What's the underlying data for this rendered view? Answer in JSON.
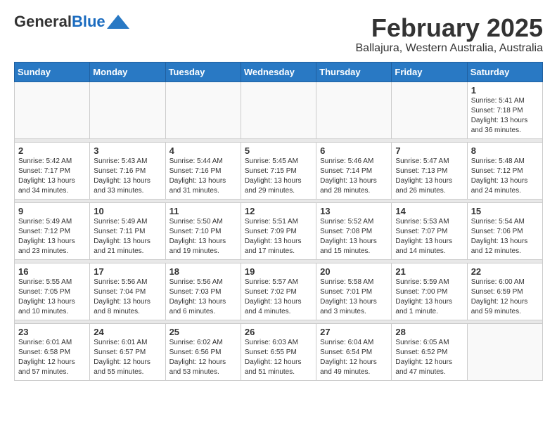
{
  "header": {
    "logo_general": "General",
    "logo_blue": "Blue",
    "title": "February 2025",
    "subtitle": "Ballajura, Western Australia, Australia"
  },
  "days_of_week": [
    "Sunday",
    "Monday",
    "Tuesday",
    "Wednesday",
    "Thursday",
    "Friday",
    "Saturday"
  ],
  "weeks": [
    {
      "days": [
        {
          "number": "",
          "info": ""
        },
        {
          "number": "",
          "info": ""
        },
        {
          "number": "",
          "info": ""
        },
        {
          "number": "",
          "info": ""
        },
        {
          "number": "",
          "info": ""
        },
        {
          "number": "",
          "info": ""
        },
        {
          "number": "1",
          "info": "Sunrise: 5:41 AM\nSunset: 7:18 PM\nDaylight: 13 hours\nand 36 minutes."
        }
      ]
    },
    {
      "days": [
        {
          "number": "2",
          "info": "Sunrise: 5:42 AM\nSunset: 7:17 PM\nDaylight: 13 hours\nand 34 minutes."
        },
        {
          "number": "3",
          "info": "Sunrise: 5:43 AM\nSunset: 7:16 PM\nDaylight: 13 hours\nand 33 minutes."
        },
        {
          "number": "4",
          "info": "Sunrise: 5:44 AM\nSunset: 7:16 PM\nDaylight: 13 hours\nand 31 minutes."
        },
        {
          "number": "5",
          "info": "Sunrise: 5:45 AM\nSunset: 7:15 PM\nDaylight: 13 hours\nand 29 minutes."
        },
        {
          "number": "6",
          "info": "Sunrise: 5:46 AM\nSunset: 7:14 PM\nDaylight: 13 hours\nand 28 minutes."
        },
        {
          "number": "7",
          "info": "Sunrise: 5:47 AM\nSunset: 7:13 PM\nDaylight: 13 hours\nand 26 minutes."
        },
        {
          "number": "8",
          "info": "Sunrise: 5:48 AM\nSunset: 7:12 PM\nDaylight: 13 hours\nand 24 minutes."
        }
      ]
    },
    {
      "days": [
        {
          "number": "9",
          "info": "Sunrise: 5:49 AM\nSunset: 7:12 PM\nDaylight: 13 hours\nand 23 minutes."
        },
        {
          "number": "10",
          "info": "Sunrise: 5:49 AM\nSunset: 7:11 PM\nDaylight: 13 hours\nand 21 minutes."
        },
        {
          "number": "11",
          "info": "Sunrise: 5:50 AM\nSunset: 7:10 PM\nDaylight: 13 hours\nand 19 minutes."
        },
        {
          "number": "12",
          "info": "Sunrise: 5:51 AM\nSunset: 7:09 PM\nDaylight: 13 hours\nand 17 minutes."
        },
        {
          "number": "13",
          "info": "Sunrise: 5:52 AM\nSunset: 7:08 PM\nDaylight: 13 hours\nand 15 minutes."
        },
        {
          "number": "14",
          "info": "Sunrise: 5:53 AM\nSunset: 7:07 PM\nDaylight: 13 hours\nand 14 minutes."
        },
        {
          "number": "15",
          "info": "Sunrise: 5:54 AM\nSunset: 7:06 PM\nDaylight: 13 hours\nand 12 minutes."
        }
      ]
    },
    {
      "days": [
        {
          "number": "16",
          "info": "Sunrise: 5:55 AM\nSunset: 7:05 PM\nDaylight: 13 hours\nand 10 minutes."
        },
        {
          "number": "17",
          "info": "Sunrise: 5:56 AM\nSunset: 7:04 PM\nDaylight: 13 hours\nand 8 minutes."
        },
        {
          "number": "18",
          "info": "Sunrise: 5:56 AM\nSunset: 7:03 PM\nDaylight: 13 hours\nand 6 minutes."
        },
        {
          "number": "19",
          "info": "Sunrise: 5:57 AM\nSunset: 7:02 PM\nDaylight: 13 hours\nand 4 minutes."
        },
        {
          "number": "20",
          "info": "Sunrise: 5:58 AM\nSunset: 7:01 PM\nDaylight: 13 hours\nand 3 minutes."
        },
        {
          "number": "21",
          "info": "Sunrise: 5:59 AM\nSunset: 7:00 PM\nDaylight: 13 hours\nand 1 minute."
        },
        {
          "number": "22",
          "info": "Sunrise: 6:00 AM\nSunset: 6:59 PM\nDaylight: 12 hours\nand 59 minutes."
        }
      ]
    },
    {
      "days": [
        {
          "number": "23",
          "info": "Sunrise: 6:01 AM\nSunset: 6:58 PM\nDaylight: 12 hours\nand 57 minutes."
        },
        {
          "number": "24",
          "info": "Sunrise: 6:01 AM\nSunset: 6:57 PM\nDaylight: 12 hours\nand 55 minutes."
        },
        {
          "number": "25",
          "info": "Sunrise: 6:02 AM\nSunset: 6:56 PM\nDaylight: 12 hours\nand 53 minutes."
        },
        {
          "number": "26",
          "info": "Sunrise: 6:03 AM\nSunset: 6:55 PM\nDaylight: 12 hours\nand 51 minutes."
        },
        {
          "number": "27",
          "info": "Sunrise: 6:04 AM\nSunset: 6:54 PM\nDaylight: 12 hours\nand 49 minutes."
        },
        {
          "number": "28",
          "info": "Sunrise: 6:05 AM\nSunset: 6:52 PM\nDaylight: 12 hours\nand 47 minutes."
        },
        {
          "number": "",
          "info": ""
        }
      ]
    }
  ]
}
